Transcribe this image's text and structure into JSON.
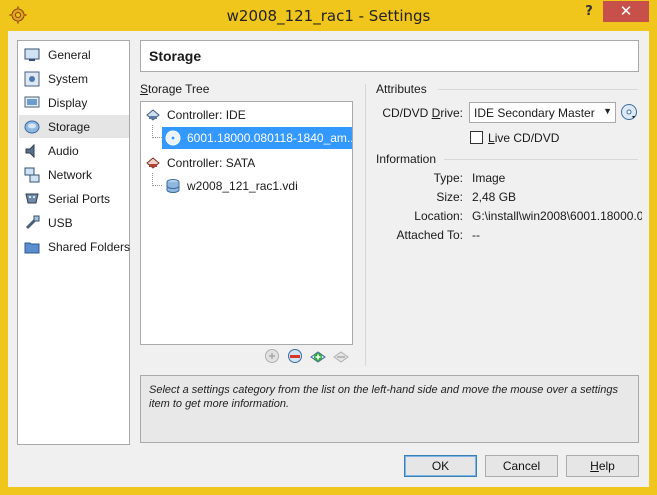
{
  "window": {
    "title": "w2008_121_rac1 - Settings",
    "help_glyph": "?",
    "close_glyph": "✕"
  },
  "nav": {
    "items": [
      {
        "label": "General",
        "icon": "general-icon"
      },
      {
        "label": "System",
        "icon": "system-icon"
      },
      {
        "label": "Display",
        "icon": "display-icon"
      },
      {
        "label": "Storage",
        "icon": "storage-icon",
        "selected": true
      },
      {
        "label": "Audio",
        "icon": "audio-icon"
      },
      {
        "label": "Network",
        "icon": "network-icon"
      },
      {
        "label": "Serial Ports",
        "icon": "serial-ports-icon"
      },
      {
        "label": "USB",
        "icon": "usb-icon"
      },
      {
        "label": "Shared Folders",
        "icon": "shared-folders-icon"
      }
    ]
  },
  "page": {
    "title": "Storage"
  },
  "storage_tree": {
    "label_prefix": "S",
    "label_rest": "torage Tree",
    "controllers": [
      {
        "name": "Controller: IDE",
        "items": [
          {
            "name": "6001.18000.080118-1840_am...",
            "type": "cd",
            "selected": true
          }
        ]
      },
      {
        "name": "Controller: SATA",
        "items": [
          {
            "name": "w2008_121_rac1.vdi",
            "type": "disk",
            "selected": false
          }
        ]
      }
    ]
  },
  "attributes": {
    "heading": "Attributes",
    "drive_label_pre": "CD/DVD ",
    "drive_label_u": "D",
    "drive_label_post": "rive:",
    "drive_value": "IDE Secondary Master",
    "live_u": "L",
    "live_rest": "ive CD/DVD",
    "live_checked": false
  },
  "information": {
    "heading": "Information",
    "rows": [
      {
        "label": "Type:",
        "value": "Image"
      },
      {
        "label": "Size:",
        "value": "2,48 GB"
      },
      {
        "label": "Location:",
        "value": "G:\\install\\win2008\\6001.18000.0..."
      },
      {
        "label": "Attached To:",
        "value": "--"
      }
    ]
  },
  "help_text": "Select a settings category from the list on the left-hand side and move the mouse over a settings item to get more information.",
  "buttons": {
    "ok": "OK",
    "cancel": "Cancel",
    "help_u": "H",
    "help_rest": "elp"
  },
  "colors": {
    "frame": "#f0c51c",
    "selection": "#3399ff",
    "close": "#c7504a"
  }
}
